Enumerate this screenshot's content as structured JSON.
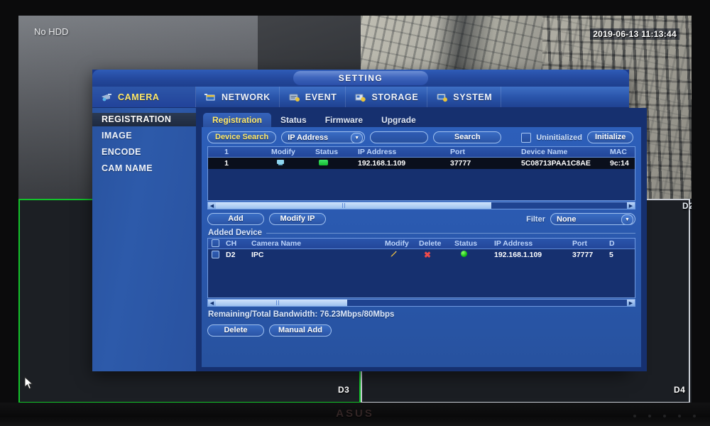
{
  "monitor": {
    "brand": "ASUS"
  },
  "video": {
    "no_hdd_label": "No HDD",
    "timestamp": "2019-06-13 11:13:44",
    "channels": [
      {
        "id": "d1",
        "label": ""
      },
      {
        "id": "d2",
        "label": "D2"
      },
      {
        "id": "d3",
        "label": "D3"
      },
      {
        "id": "d4",
        "label": "D4"
      }
    ]
  },
  "dialog": {
    "title": "SETTING",
    "menu": [
      {
        "label": "CAMERA",
        "icon": "camera-icon",
        "active": true
      },
      {
        "label": "NETWORK",
        "icon": "network-icon",
        "active": false
      },
      {
        "label": "EVENT",
        "icon": "event-icon",
        "active": false
      },
      {
        "label": "STORAGE",
        "icon": "storage-icon",
        "active": false
      },
      {
        "label": "SYSTEM",
        "icon": "system-icon",
        "active": false
      }
    ],
    "sidebar": [
      {
        "label": "REGISTRATION",
        "active": true
      },
      {
        "label": "IMAGE",
        "active": false
      },
      {
        "label": "ENCODE",
        "active": false
      },
      {
        "label": "CAM NAME",
        "active": false
      }
    ],
    "tabs": [
      {
        "label": "Registration",
        "active": true
      },
      {
        "label": "Status",
        "active": false
      },
      {
        "label": "Firmware",
        "active": false
      },
      {
        "label": "Upgrade",
        "active": false
      }
    ],
    "toolbar": {
      "device_search_label": "Device Search",
      "search_type_value": "IP Address",
      "search_input_value": "",
      "search_button_label": "Search",
      "uninitialized_label": "Uninitialized",
      "uninitialized_checked": false,
      "initialize_label": "Initialize"
    },
    "search_table": {
      "headers": [
        "1",
        "",
        "Modify",
        "Status",
        "IP Address",
        "Port",
        "Device Name",
        "MAC"
      ],
      "rows": [
        {
          "index": "1",
          "checked": false,
          "modify": "modify-icon",
          "status": "online",
          "ip_address": "192.168.1.109",
          "port": "37777",
          "device_name": "5C08713PAA1C8AE",
          "mac": "9c:14",
          "selected": true
        }
      ]
    },
    "middle_bar": {
      "add_label": "Add",
      "modify_ip_label": "Modify IP",
      "filter_label": "Filter",
      "filter_value": "None"
    },
    "added_device": {
      "section_title": "Added Device",
      "headers": [
        "",
        "CH",
        "Camera Name",
        "Modify",
        "Delete",
        "Status",
        "IP Address",
        "Port",
        "D"
      ],
      "rows": [
        {
          "checked": false,
          "ch": "D2",
          "camera_name": "IPC",
          "modify": "pencil-icon",
          "delete": "x-icon",
          "status": "online",
          "ip_address": "192.168.1.109",
          "port": "37777",
          "extra": "5"
        }
      ]
    },
    "bandwidth_text": "Remaining/Total Bandwidth: 76.23Mbps/80Mbps",
    "footer": {
      "delete_label": "Delete",
      "manual_add_label": "Manual Add"
    }
  },
  "colors": {
    "dialog_blue": "#2a55ab",
    "accent_yellow": "#ffe96b",
    "selection_green": "#13c32b",
    "status_green": "#16c416",
    "delete_red": "#ef4a4a",
    "modify_amber": "#f0c040"
  }
}
